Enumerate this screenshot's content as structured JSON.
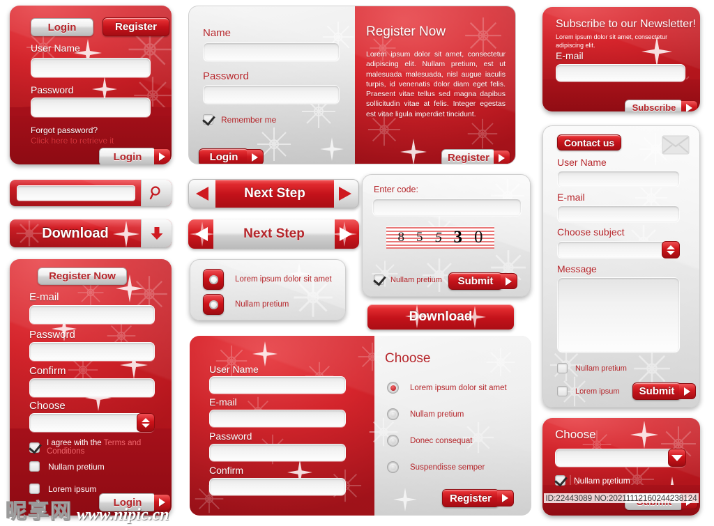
{
  "meta": {
    "watermark_cn": "昵享网",
    "watermark_url": "www.nipic.cn",
    "watermark_id": "ID:22443089 NO:20211112160244238124"
  },
  "login_panel": {
    "tab_login": "Login",
    "tab_register": "Register",
    "username_label": "User Name",
    "password_label": "Password",
    "forgot_line1": "Forgot password?",
    "forgot_line2": "Click here to retrieve it",
    "submit_label": "Login"
  },
  "register_now_panel": {
    "name_label": "Name",
    "password_label": "Password",
    "remember_label": "Remember  me",
    "login_label": "Login",
    "title": "Register Now",
    "body": "Lorem ipsum dolor sit amet, consectetur adipiscing elit. Nullam pretium, est ut malesuada malesuada, nisl augue iaculis turpis, id venenatis dolor diam eget felis. Praesent vitae tellus sed magna dapibus sollicitudin vitae at felis. Integer egestas est vitae ligula imperdiet tincidunt.",
    "register_label": "Register"
  },
  "newsletter_panel": {
    "title": "Subscribe to our Newsletter!",
    "body": "Lorem ipsum dolor sit amet, consectetur adipiscing elit.",
    "email_label": "E-mail",
    "subscribe_label": "Subscribe"
  },
  "contact_panel": {
    "title": "Contact us",
    "username_label": "User Name",
    "email_label": "E-mail",
    "subject_label": "Choose subject",
    "message_label": "Message",
    "check1_label": "Nullam pretium",
    "check2_label": "Lorem ipsum",
    "submit_label": "Submit",
    "envelope_icon": "envelope-icon"
  },
  "search_bar": {
    "placeholder": "",
    "value": "",
    "icon": "search-icon"
  },
  "download_bar": {
    "label": "Download",
    "icon": "download-arrow-icon"
  },
  "next_step_red": {
    "label": "Next Step",
    "left_icon": "arrow-left-icon",
    "right_icon": "arrow-right-icon"
  },
  "next_step_silver": {
    "label": "Next Step",
    "left_icon": "arrow-left-icon",
    "right_icon": "arrow-right-icon"
  },
  "radio_card": {
    "options": [
      {
        "label": "Lorem ipsum dolor sit amet",
        "selected": true
      },
      {
        "label": "Nullam pretium",
        "selected": false
      }
    ]
  },
  "captcha_panel": {
    "title": "Enter code:",
    "code": "85530",
    "code_digits": [
      "8",
      "5",
      "5",
      "3",
      "0"
    ],
    "check_label": "Nullam pretium",
    "submit_label": "Submit"
  },
  "download_button": {
    "label": "Download"
  },
  "register_left_panel": {
    "title": "Register Now",
    "email_label": "E-mail",
    "password_label": "Password",
    "confirm_label": "Confirm",
    "choose_label": "Choose",
    "agree_prefix": "I agree with the ",
    "agree_link": "Terms and Conditions",
    "check1_label": "Nullam pretium",
    "check2_label": "Lorem ipsum",
    "submit_label": "Login"
  },
  "register_wide_panel": {
    "username_label": "User Name",
    "email_label": "E-mail",
    "password_label": "Password",
    "confirm_label": "Confirm",
    "choose_title": "Choose",
    "options": [
      {
        "label": "Lorem ipsum dolor sit amet",
        "selected": true
      },
      {
        "label": "Nullam pretium",
        "selected": false
      },
      {
        "label": "Donec consequat",
        "selected": false
      },
      {
        "label": "Suspendisse semper",
        "selected": false
      }
    ],
    "register_label": "Register"
  },
  "choose_small_panel": {
    "title": "Choose",
    "check_label": "Nullam pretium",
    "submit_label": "Submit"
  },
  "colors": {
    "red_light": "#e8454a",
    "red_mid": "#d6252c",
    "red_dark": "#b4151c",
    "red_text": "#b5262b",
    "silver_light": "#fdfdfd",
    "silver_dark": "#bcbcbc",
    "link_red": "#e24a4a"
  }
}
